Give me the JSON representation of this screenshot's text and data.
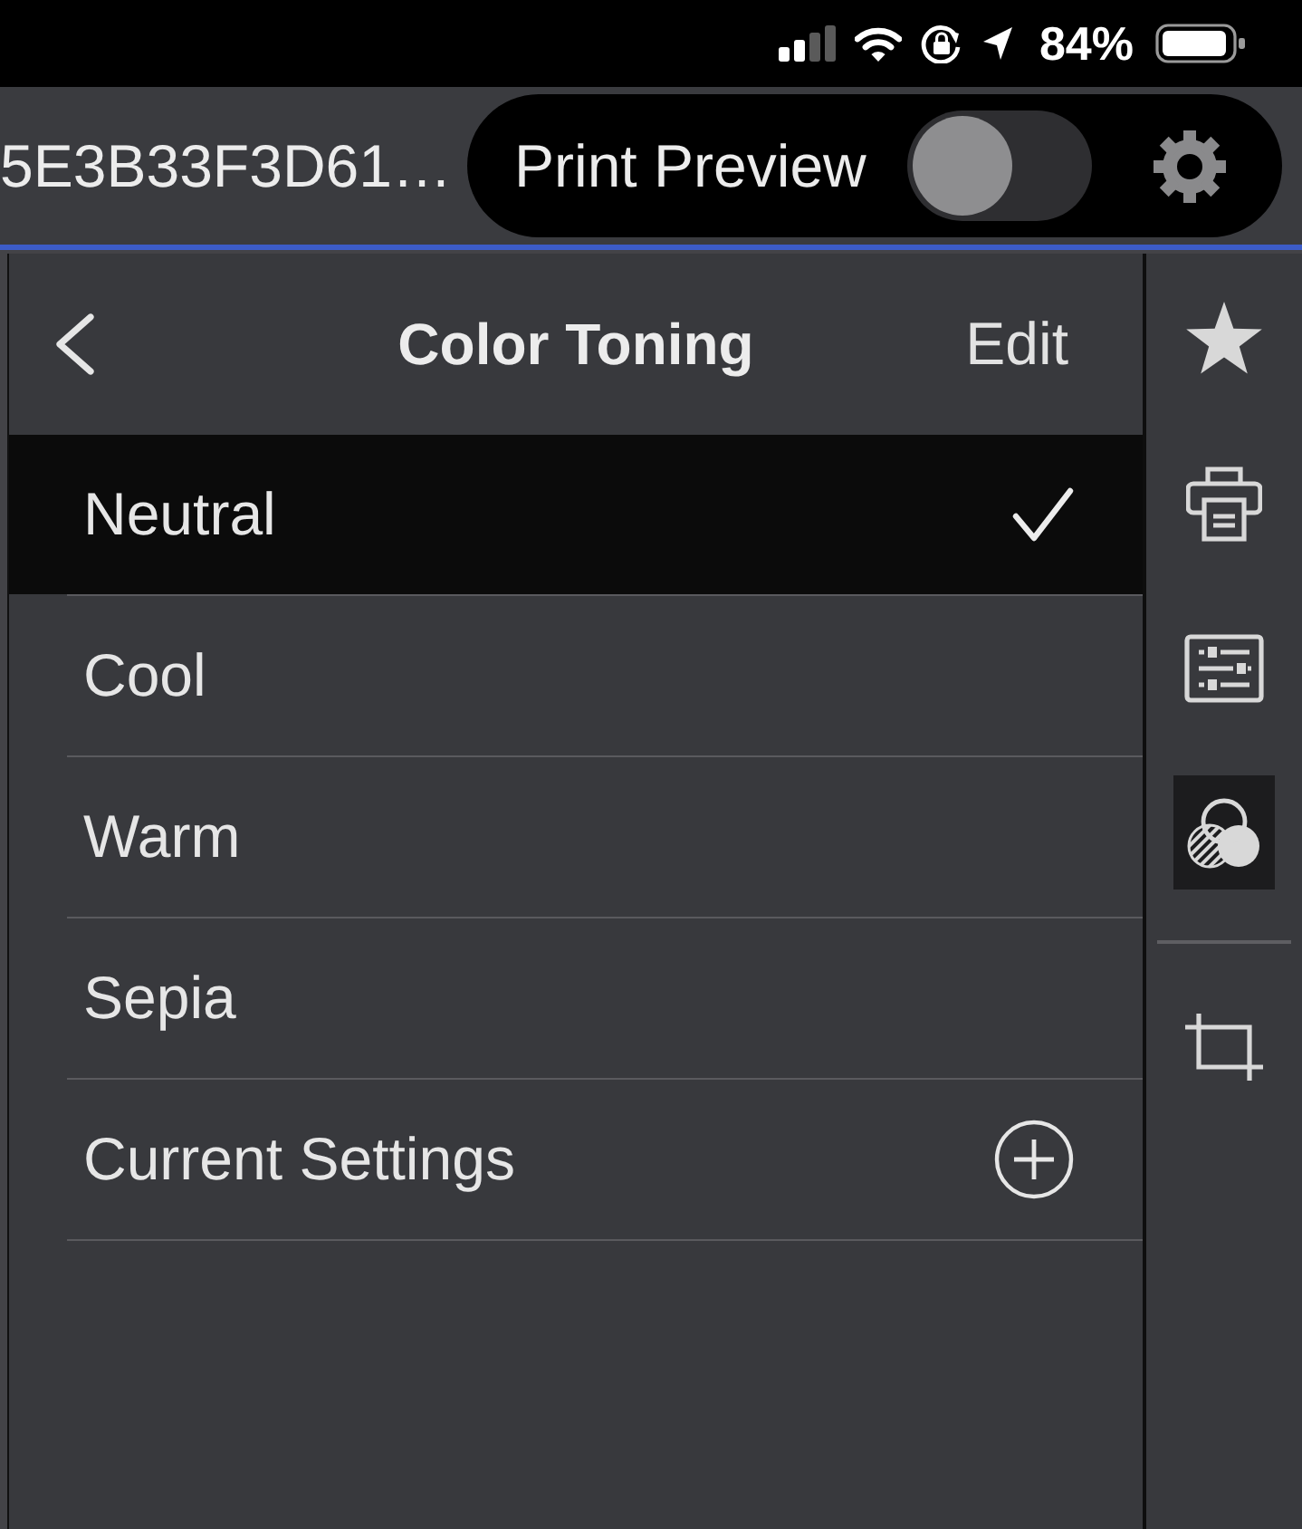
{
  "status_bar": {
    "battery_percent": "84%"
  },
  "top_bar": {
    "document_title": "5E3B33F3D61…",
    "print_preview": {
      "label": "Print Preview",
      "on": false
    }
  },
  "panel": {
    "title": "Color Toning",
    "action": "Edit",
    "items": [
      {
        "label": "Neutral",
        "kind": "preset",
        "selected": true
      },
      {
        "label": "Cool",
        "kind": "preset",
        "selected": false
      },
      {
        "label": "Warm",
        "kind": "preset",
        "selected": false
      },
      {
        "label": "Sepia",
        "kind": "preset",
        "selected": false
      },
      {
        "label": "Current Settings",
        "kind": "add",
        "selected": false
      }
    ]
  },
  "toolbar": {
    "groups": [
      {
        "tools": [
          {
            "kind": "favorites",
            "selected": false
          },
          {
            "kind": "print",
            "selected": false
          },
          {
            "kind": "adjust",
            "selected": false
          },
          {
            "kind": "toning",
            "selected": true
          }
        ]
      },
      {
        "tools": [
          {
            "kind": "crop",
            "selected": false
          }
        ]
      }
    ]
  }
}
